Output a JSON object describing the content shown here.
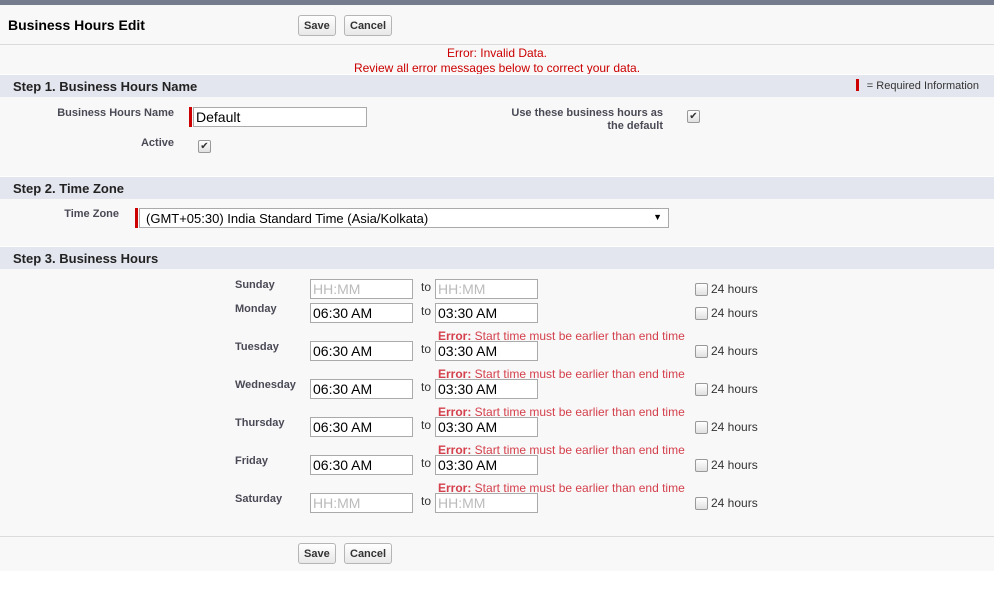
{
  "header": {
    "title": "Business Hours Edit",
    "save": "Save",
    "cancel": "Cancel"
  },
  "errors": {
    "line1": "Error: Invalid Data.",
    "line2": "Review all error messages below to correct your data."
  },
  "step1": {
    "title": "Step 1. Business Hours Name",
    "required_legend": "= Required Information",
    "name_label": "Business Hours Name",
    "name_value": "Default",
    "default_label_1": "Use these business hours as",
    "default_label_2": "the default",
    "default_checked": true,
    "active_label": "Active",
    "active_checked": true
  },
  "step2": {
    "title": "Step 2. Time Zone",
    "tz_label": "Time Zone",
    "tz_value": "(GMT+05:30) India Standard Time (Asia/Kolkata)"
  },
  "step3": {
    "title": "Step 3. Business Hours",
    "to_label": "to",
    "h24_label": "24 hours",
    "placeholder": "HH:MM",
    "error_prefix": "Error:",
    "error_text": " Start time must be earlier than end time",
    "days": [
      {
        "name": "Sunday",
        "start": "",
        "end": "",
        "error": false
      },
      {
        "name": "Monday",
        "start": "06:30 AM",
        "end": "03:30 AM",
        "error": true
      },
      {
        "name": "Tuesday",
        "start": "06:30 AM",
        "end": "03:30 AM",
        "error": true
      },
      {
        "name": "Wednesday",
        "start": "06:30 AM",
        "end": "03:30 AM",
        "error": true
      },
      {
        "name": "Thursday",
        "start": "06:30 AM",
        "end": "03:30 AM",
        "error": true
      },
      {
        "name": "Friday",
        "start": "06:30 AM",
        "end": "03:30 AM",
        "error": true
      },
      {
        "name": "Saturday",
        "start": "",
        "end": "",
        "error": false
      }
    ]
  }
}
